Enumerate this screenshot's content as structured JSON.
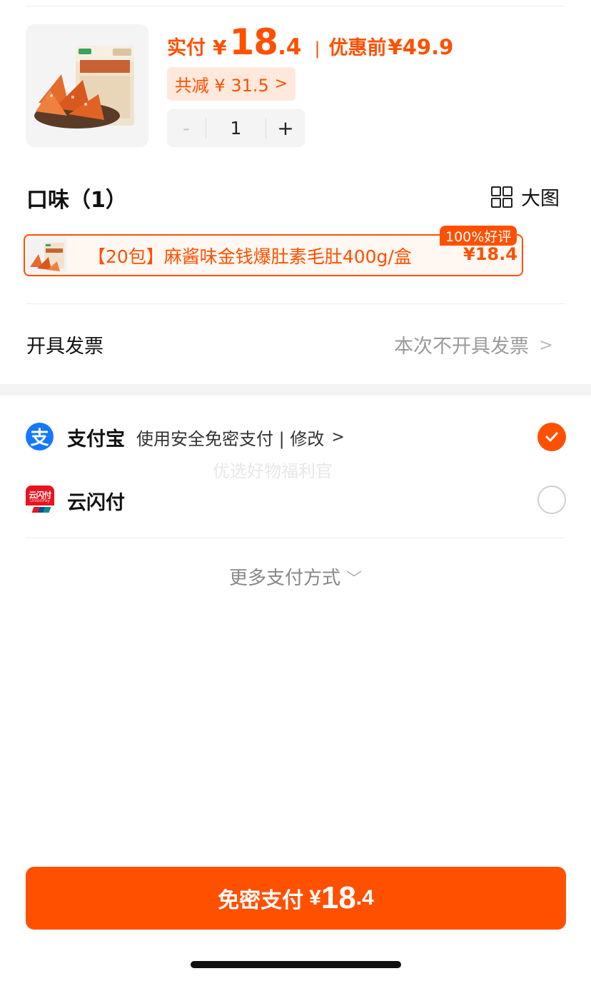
{
  "product": {
    "image_icon": "snack-product-image",
    "paid_label": "实付",
    "yen": "¥",
    "paid_int": "18",
    "paid_dec": ".4",
    "separator": "|",
    "before_label": "优惠前",
    "before_price": "¥49.9",
    "discount_text": "共减 ¥ 31.5",
    "discount_chevron": ">",
    "quantity": {
      "minus": "-",
      "value": "1",
      "plus": "+"
    }
  },
  "flavor": {
    "title": "口味（1）",
    "big_image_icon": "grid-icon",
    "big_image_label": "大图",
    "options": [
      {
        "name": "【20包】麻酱味金钱爆肚素毛肚400g/盒",
        "price": "¥18.4",
        "badge": "100%好评",
        "selected": true
      }
    ]
  },
  "invoice": {
    "label": "开具发票",
    "value": "本次不开具发票",
    "chevron": ">"
  },
  "payment": {
    "watermark": "优选好物福利官",
    "methods": [
      {
        "icon": "alipay-icon",
        "logo_char": "支",
        "name": "支付宝",
        "desc": "使用安全免密支付 | 修改",
        "chevron": ">",
        "selected": true
      },
      {
        "icon": "unionpay-icon",
        "logo_text": "云闪付",
        "logo_sub": "UnionPay",
        "name": "云闪付",
        "selected": false
      }
    ],
    "more_label": "更多支付方式",
    "more_chevron": "﹀"
  },
  "cta": {
    "label": "免密支付",
    "yen": "¥",
    "amount_int": "18",
    "amount_dec": ".4"
  },
  "colors": {
    "accent": "#ff5000",
    "alipay": "#1677ff",
    "unionpay": "#e8141d"
  }
}
